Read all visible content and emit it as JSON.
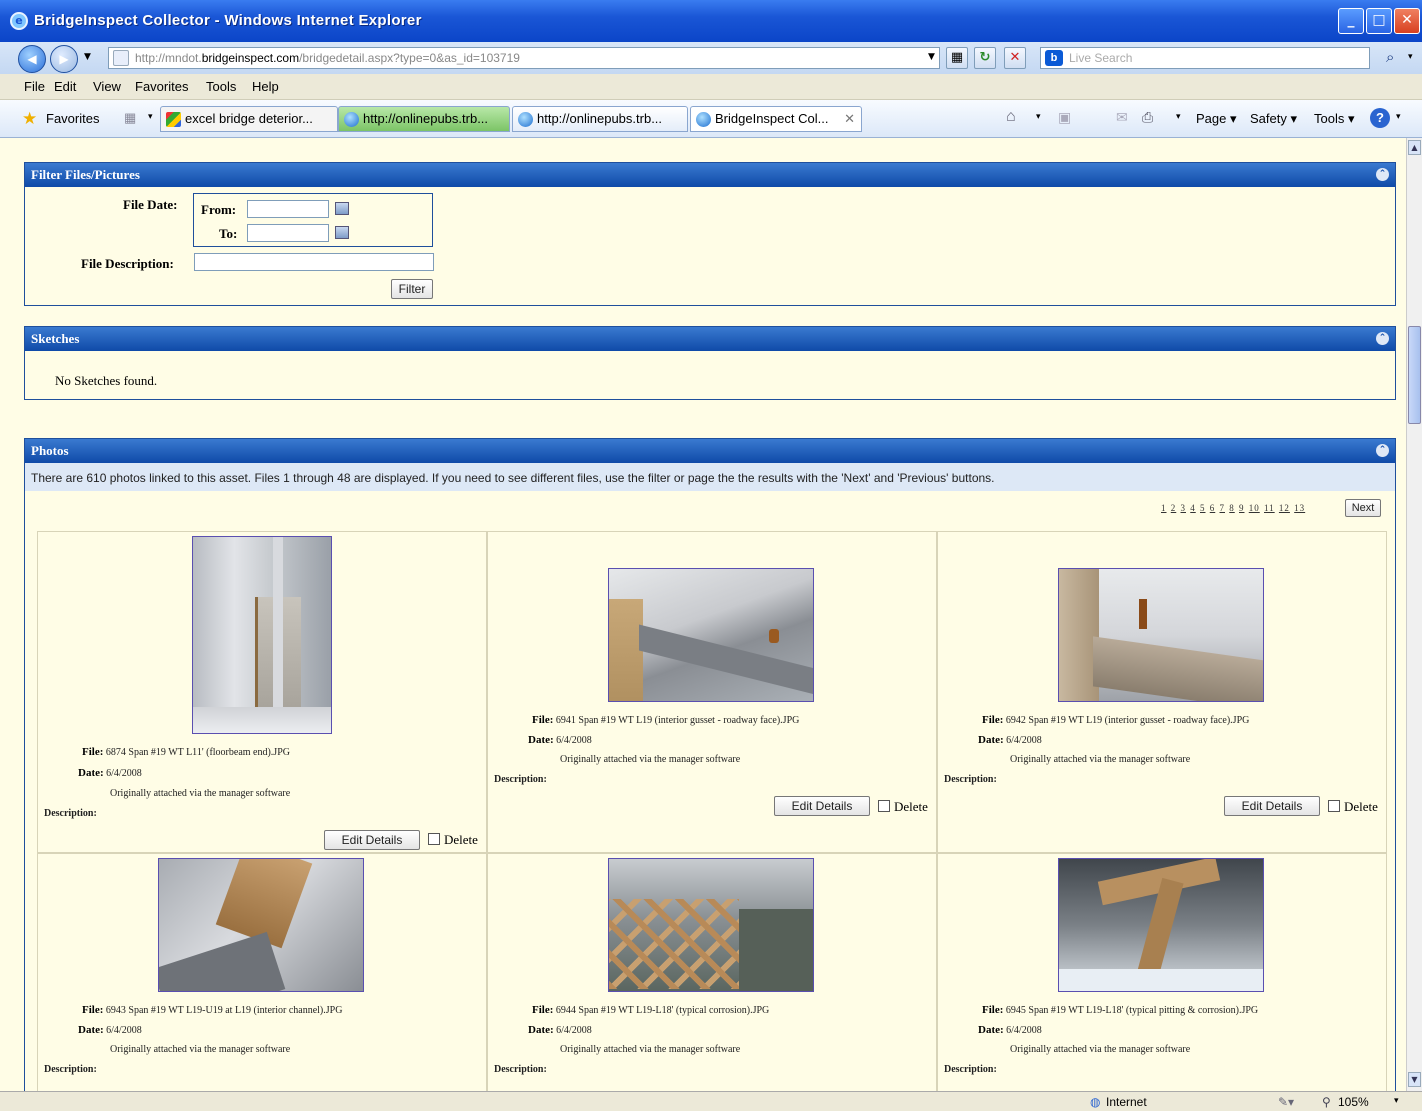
{
  "window": {
    "title": "BridgeInspect Collector - Windows Internet Explorer"
  },
  "address": {
    "url_prefix": "http://mndot.",
    "url_domain": "bridgeinspect.com",
    "url_rest": "/bridgedetail.aspx?type=0&as_id=103719",
    "search_placeholder": "Live Search"
  },
  "menu": [
    "File",
    "Edit",
    "View",
    "Favorites",
    "Tools",
    "Help"
  ],
  "favorites": {
    "label": "Favorites",
    "tabs": [
      "excel bridge deterior...",
      "http://onlinepubs.trb...",
      "http://onlinepubs.trb...",
      "BridgeInspect Col..."
    ],
    "commands": [
      "Page ▾",
      "Safety ▾",
      "Tools ▾"
    ]
  },
  "filter": {
    "title": "Filter Files/Pictures",
    "file_date": "File Date:",
    "from": "From:",
    "to": "To:",
    "file_description": "File Description:",
    "button": "Filter"
  },
  "sketches": {
    "title": "Sketches",
    "empty": "No Sketches found."
  },
  "photos": {
    "title": "Photos",
    "note": "There are 610 photos linked to this asset. Files 1 through 48 are displayed. If you need to see different files, use the filter or page the the results with the 'Next' and 'Previous' buttons.",
    "pages": [
      "1",
      "2",
      "3",
      "4",
      "5",
      "6",
      "7",
      "8",
      "9",
      "10",
      "11",
      "12",
      "13"
    ],
    "next": "Next",
    "file_label": "File:",
    "date_label": "Date:",
    "desc_label": "Description:",
    "edit_label": "Edit Details",
    "delete_label": "Delete",
    "items": [
      {
        "file": "6874 Span #19 WT L11' (floorbeam end).JPG",
        "date": "6/4/2008",
        "note": "Originally attached via the manager software"
      },
      {
        "file": "6941 Span #19 WT L19 (interior gusset - roadway face).JPG",
        "date": "6/4/2008",
        "note": "Originally attached via the manager software"
      },
      {
        "file": "6942 Span #19 WT L19 (interior gusset - roadway face).JPG",
        "date": "6/4/2008",
        "note": "Originally attached via the manager software"
      },
      {
        "file": "6943 Span #19 WT L19-U19 at L19 (interior channel).JPG",
        "date": "6/4/2008",
        "note": "Originally attached via the manager software"
      },
      {
        "file": "6944 Span #19 WT L19-L18' (typical corrosion).JPG",
        "date": "6/4/2008",
        "note": "Originally attached via the manager software"
      },
      {
        "file": "6945 Span #19 WT L19-L18' (typical pitting & corrosion).JPG",
        "date": "6/4/2008",
        "note": "Originally attached via the manager software"
      }
    ]
  },
  "status": {
    "zone": "Internet",
    "zoom": "105%"
  }
}
